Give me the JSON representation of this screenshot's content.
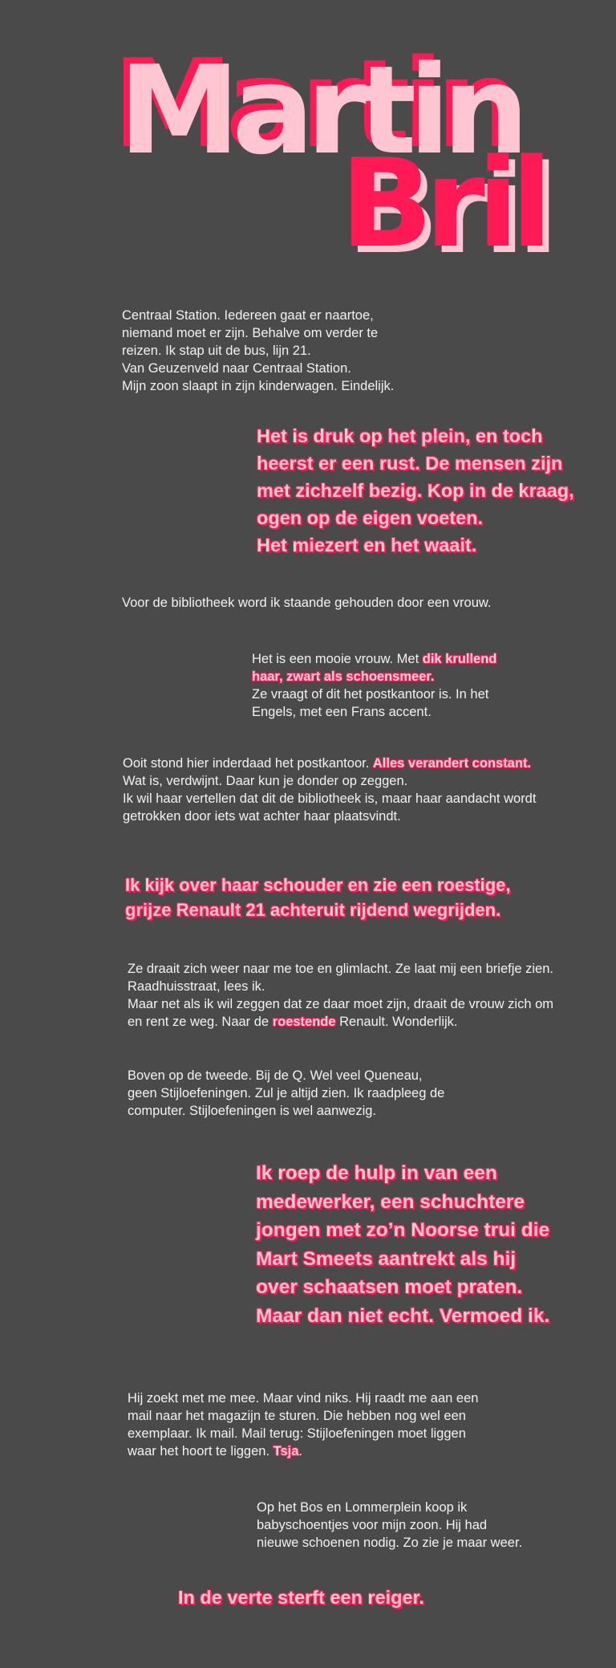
{
  "title": {
    "first": "Martin",
    "last": "Bril"
  },
  "colors": {
    "background": "#4a4a4a",
    "accent": "#ff1a55",
    "pink": "#ffc6d1",
    "text": "#f2f2f2"
  },
  "blocks": {
    "p1": [
      "Centraal Station. Iedereen gaat er naartoe,",
      "niemand moet er zijn. Behalve om verder te",
      "reizen. Ik stap uit de bus, lijn 21.",
      "Van Geuzenveld naar Centraal Station.",
      "Mijn zoon slaapt in zijn kinderwagen. Eindelijk."
    ],
    "q1": [
      "Het is druk op het plein, en toch",
      "heerst er een rust. De mensen zijn",
      "met zichzelf bezig. Kop in de kraag,",
      "ogen op de eigen voeten.",
      "Het miezert en het waait."
    ],
    "p2": "Voor de bibliotheek word ik staande gehouden door een vrouw.",
    "p3": {
      "l1a": "Het is een mooie vrouw. Met ",
      "l1b": "dik krullend",
      "l2": "haar, zwart als schoensmeer.",
      "l3": "Ze vraagt of dit het postkantoor is. In het",
      "l4": "Engels, met een Frans accent."
    },
    "p4": {
      "l1a": "Ooit stond hier inderdaad het postkantoor. ",
      "l1b": "Alles verandert constant.",
      "l2": "Wat is, verdwijnt. Daar kun je donder op zeggen.",
      "l3": "Ik wil haar vertellen dat dit de bibliotheek is, maar haar aandacht wordt",
      "l4": "getrokken door iets wat achter haar plaatsvindt."
    },
    "q2": [
      "Ik kijk over haar schouder en zie een roestige,",
      "grijze Renault 21 achteruit rijdend wegrijden."
    ],
    "p5": {
      "l1": "Ze draait zich weer naar me toe en glimlacht. Ze laat mij een briefje zien.",
      "l2": "Raadhuisstraat, lees ik.",
      "l3": "Maar net als ik wil zeggen dat ze daar moet zijn, draait de vrouw zich om",
      "l4a": "en rent ze weg. Naar de ",
      "l4b": "roestende",
      "l4c": " Renault. Wonderlijk."
    },
    "p6": [
      "Boven op de tweede. Bij de Q. Wel veel Queneau,",
      "geen Stijloefeningen. Zul je altijd zien. Ik raadpleeg de",
      "computer. Stijloefeningen is wel aanwezig."
    ],
    "q3": [
      "Ik roep de hulp in van een",
      "medewerker, een schuchtere",
      "jongen met zo’n Noorse trui die",
      "Mart Smeets aantrekt als hij",
      "over schaatsen moet praten.",
      "Maar dan niet echt. Vermoed ik."
    ],
    "p7": {
      "l1": "Hij zoekt met me mee. Maar vind niks. Hij raadt me aan een",
      "l2": "mail naar het magazijn te sturen. Die hebben nog wel een",
      "l3": "exemplaar. Ik mail. Mail terug: Stijloefeningen moet liggen",
      "l4a": "waar het hoort te liggen. ",
      "l4b": "Tsja",
      "l4c": "."
    },
    "p8": [
      "Op het Bos en Lommerplein koop ik",
      "babyschoentjes voor mijn zoon. Hij had",
      "nieuwe schoenen nodig. Zo zie je maar weer."
    ],
    "q4": "In de verte sterft een reiger."
  }
}
